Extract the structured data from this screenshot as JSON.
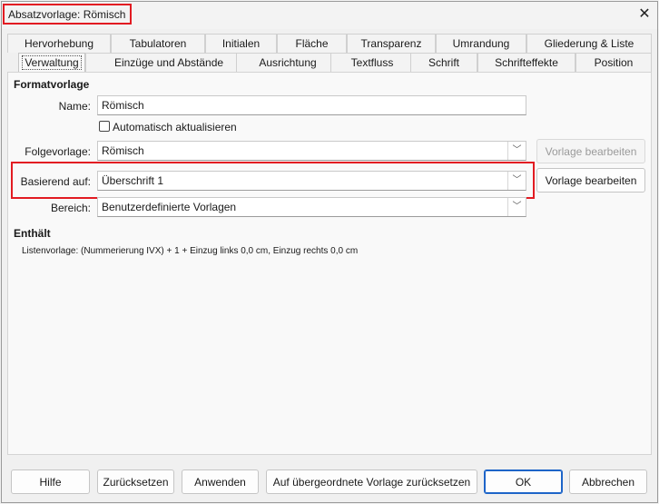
{
  "window": {
    "title": "Absatzvorlage: Römisch",
    "close_icon": "close-icon"
  },
  "tabs": {
    "row1": [
      "Hervorhebung",
      "Tabulatoren",
      "Initialen",
      "Fläche",
      "Transparenz",
      "Umrandung",
      "Gliederung & Liste"
    ],
    "row2": [
      "Verwaltung",
      "Einzüge und Abstände",
      "Ausrichtung",
      "Textfluss",
      "Schrift",
      "Schrifteffekte",
      "Position"
    ],
    "active": "Verwaltung"
  },
  "form": {
    "section_title": "Formatvorlage",
    "name_label": "Name:",
    "name_value": "Römisch",
    "auto_update_label": "Automatisch aktualisieren",
    "auto_update_checked": false,
    "next_style_label": "Folgevorlage:",
    "next_style_value": "Römisch",
    "next_style_edit": "Vorlage bearbeiten",
    "inherit_label": "Basierend auf:",
    "inherit_value": "Überschrift 1",
    "inherit_edit": "Vorlage bearbeiten",
    "category_label": "Bereich:",
    "category_value": "Benutzerdefinierte Vorlagen"
  },
  "contains": {
    "title": "Enthält",
    "text": "Listenvorlage: (Nummerierung IVX) + 1 + Einzug links 0,0 cm, Einzug rechts 0,0 cm"
  },
  "buttons": {
    "help": "Hilfe",
    "reset": "Zurücksetzen",
    "apply": "Anwenden",
    "standard": "Auf übergeordnete Vorlage zurücksetzen",
    "ok": "OK",
    "cancel": "Abbrechen"
  },
  "colors": {
    "highlight": "#e21b22",
    "default_button_border": "#1d64c8"
  }
}
